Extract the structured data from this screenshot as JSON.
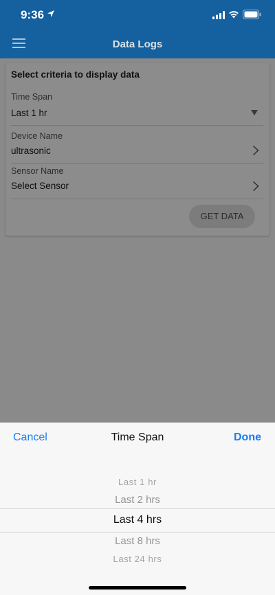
{
  "status": {
    "time": "9:36"
  },
  "header": {
    "title": "Data Logs",
    "menu_icon": "hamburger-icon"
  },
  "card": {
    "title": "Select criteria to display data",
    "time_span": {
      "label": "Time Span",
      "value": "Last 1 hr"
    },
    "device": {
      "label": "Device Name",
      "value": "ultrasonic"
    },
    "sensor": {
      "label": "Sensor Name",
      "value": "Select Sensor"
    },
    "get_data_label": "GET DATA"
  },
  "picker": {
    "cancel_label": "Cancel",
    "title": "Time Span",
    "done_label": "Done",
    "options": [
      "Last 1 hr",
      "Last 2 hrs",
      "Last 4 hrs",
      "Last 8 hrs",
      "Last 24 hrs"
    ],
    "selected": "Last 4 hrs"
  },
  "colors": {
    "header": "#15609e",
    "accent": "#1a7cf5",
    "overlay": "#8a8a8a"
  }
}
